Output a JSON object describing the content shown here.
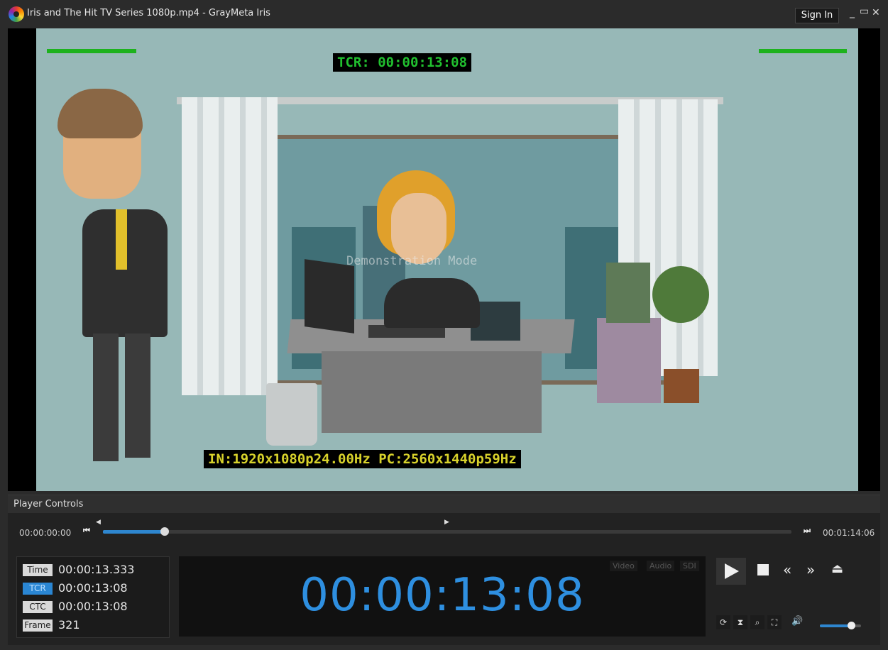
{
  "window": {
    "title": "Iris and The Hit TV Series 1080p.mp4  -  GrayMeta Iris",
    "sign_in": "Sign In",
    "minimize_icon": "minimize-icon",
    "maximize_icon": "maximize-icon",
    "close_icon": "close-icon"
  },
  "video": {
    "tcr_overlay": "TCR: 00:00:13:08",
    "format_overlay": "IN:1920x1080p24.00Hz PC:2560x1440p59Hz",
    "watermark": "Demonstration Mode"
  },
  "player_controls": {
    "title": "Player Controls",
    "start_time": "00:00:00:00",
    "end_time": "00:01:14:06",
    "progress": 0.09,
    "timecodes": [
      {
        "label": "Time",
        "value": "00:00:13.333",
        "active": false
      },
      {
        "label": "TCR",
        "value": "00:00:13:08",
        "active": true
      },
      {
        "label": "CTC",
        "value": "00:00:13:08",
        "active": false
      },
      {
        "label": "Frame",
        "value": "321",
        "active": false
      }
    ],
    "big_timecode": "00:00:13:08",
    "mode_tabs": [
      "Video",
      "Audio",
      "SDI"
    ],
    "volume": 0.75
  },
  "colors": {
    "accent": "#2e8fe0",
    "meter_green": "#1db21d",
    "tcr_green": "#21c02f",
    "format_yellow": "#d8d22b"
  }
}
